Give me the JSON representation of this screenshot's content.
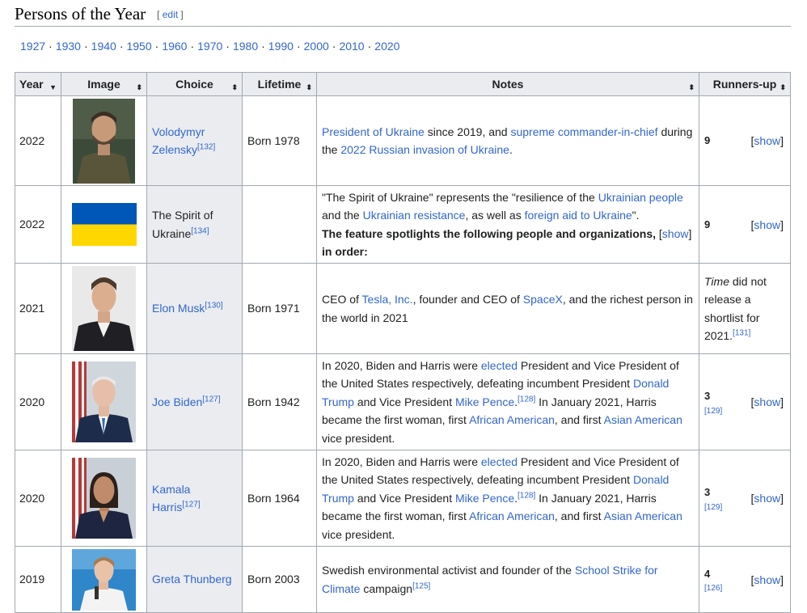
{
  "heading": {
    "title": "Persons of the Year",
    "edit": "edit"
  },
  "decades": [
    "1927",
    "1930",
    "1940",
    "1950",
    "1960",
    "1970",
    "1980",
    "1990",
    "2000",
    "2010",
    "2020"
  ],
  "columns": {
    "year": "Year",
    "image": "Image",
    "choice": "Choice",
    "lifetime": "Lifetime",
    "notes": "Notes",
    "runners": "Runners-up"
  },
  "show_label": "show",
  "colors": {
    "link": "#3366cc",
    "header_bg": "#eaecf0",
    "border": "#a2a9b1",
    "flag_blue": "#0057b7",
    "flag_yellow": "#ffd700"
  },
  "rows": [
    {
      "year": "2022",
      "choice_link": "Volodymyr Zelensky",
      "choice_ref": "[132]",
      "lifetime": "Born 1978",
      "notes": {
        "l1": "President of Ukraine",
        "t1": " since 2019, and ",
        "l2": "supreme commander-in-chief",
        "t2": " during the ",
        "l3": "2022 Russian invasion of Ukraine",
        "t3": "."
      },
      "runners_count": "9"
    },
    {
      "year": "2022",
      "choice_text": "The Spirit of Ukraine",
      "choice_ref": "[134]",
      "lifetime": "",
      "notes": {
        "t1": "\"The Spirit of Ukraine\" represents the \"resilience of the ",
        "l1": "Ukrainian people",
        "t2": " and the ",
        "l2": "Ukrainian resistance",
        "t3": ", as well as ",
        "l3": "foreign aid to Ukraine",
        "t4": "\".",
        "bold1": "The feature spotlights the following people and organizations,",
        "bold2": "in order:"
      },
      "runners_count": "9"
    },
    {
      "year": "2021",
      "choice_link": "Elon Musk",
      "choice_ref": "[130]",
      "lifetime": "Born 1971",
      "notes": {
        "t1": "CEO of ",
        "l1": "Tesla, Inc.",
        "t2": ", founder and CEO of ",
        "l2": "SpaceX",
        "t3": ", and the richest person in the world in 2021"
      },
      "runners_italic": "Time",
      "runners_text": " did not release a shortlist for 2021.",
      "runners_ref": "[131]"
    },
    {
      "year": "2020",
      "choice_link": "Joe Biden",
      "choice_ref": "[127]",
      "lifetime": "Born 1942",
      "notes": {
        "t1": "In 2020, Biden and Harris were ",
        "l1": "elected",
        "t2": " President and Vice President of the United States respectively, defeating incumbent President ",
        "l2": "Donald Trump",
        "t3": " and Vice President ",
        "l3": "Mike Pence",
        "t4": ".",
        "ref": "[128]",
        "t5": " In January 2021, Harris became the first woman, first ",
        "l4": "African American",
        "t6": ", and first ",
        "l5": "Asian American",
        "t7": " vice president."
      },
      "runners_count": "3",
      "runners_ref": "[129]"
    },
    {
      "year": "2020",
      "choice_link": "Kamala Harris",
      "choice_ref": "[127]",
      "lifetime": "Born 1964",
      "notes": {
        "t1": "In 2020, Biden and Harris were ",
        "l1": "elected",
        "t2": " President and Vice President of the United States respectively, defeating incumbent President ",
        "l2": "Donald Trump",
        "t3": " and Vice President ",
        "l3": "Mike Pence",
        "t4": ".",
        "ref": "[128]",
        "t5": " In January 2021, Harris became the first woman, first ",
        "l4": "African American",
        "t6": ", and first ",
        "l5": "Asian American",
        "t7": " vice president."
      },
      "runners_count": "3",
      "runners_ref": "[129]"
    },
    {
      "year": "2019",
      "choice_link": "Greta Thunberg",
      "choice_ref": "",
      "lifetime": "Born 2003",
      "notes": {
        "t1": "Swedish environmental activist and founder of the ",
        "l1": "School Strike for Climate",
        "t2": " campaign",
        "ref": "[125]"
      },
      "runners_count": "4",
      "runners_ref": "[126]"
    }
  ]
}
